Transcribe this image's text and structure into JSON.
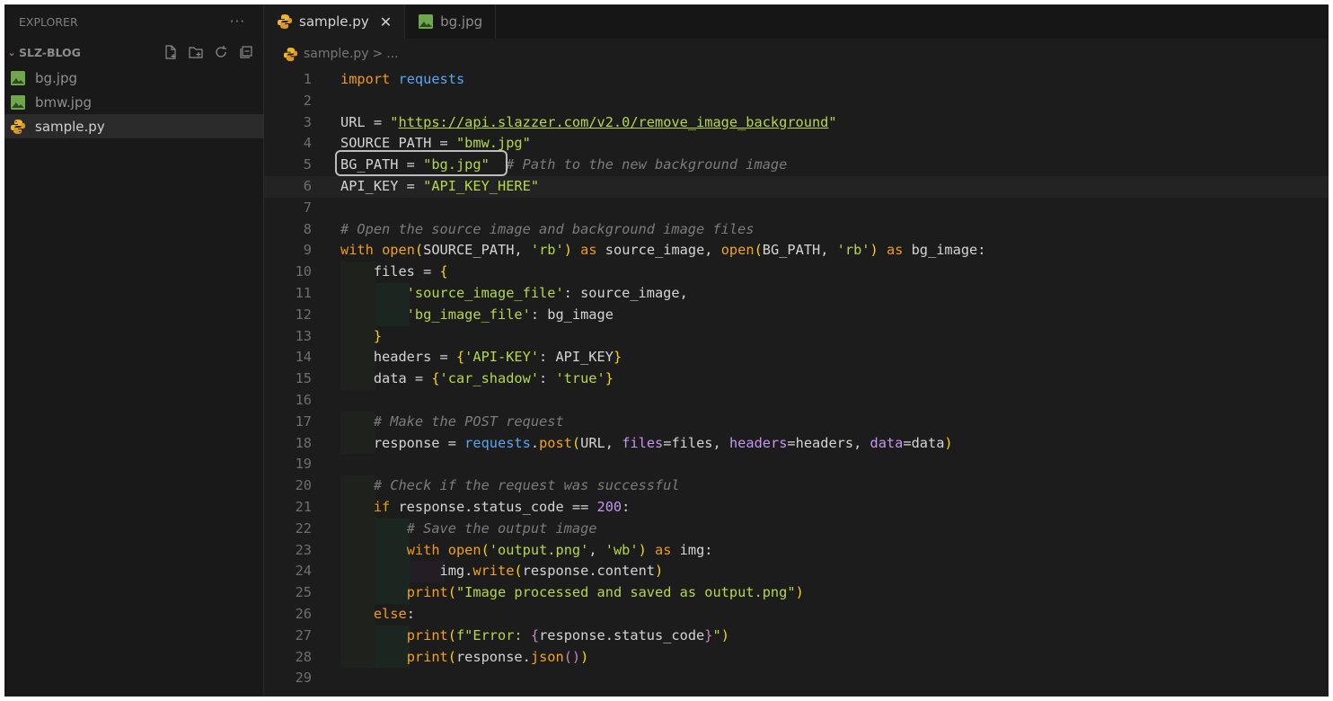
{
  "explorer": {
    "title": "EXPLORER",
    "more_icon": "ellipsis-icon",
    "folder": {
      "name": "SLZ-BLOG",
      "actions": [
        "new-file-icon",
        "new-folder-icon",
        "refresh-icon",
        "collapse-icon"
      ]
    },
    "files": [
      {
        "name": "bg.jpg",
        "icon": "image-icon",
        "active": false
      },
      {
        "name": "bmw.jpg",
        "icon": "image-icon",
        "active": false
      },
      {
        "name": "sample.py",
        "icon": "python-icon",
        "active": true
      }
    ]
  },
  "tabs": [
    {
      "label": "sample.py",
      "icon": "python-icon",
      "active": true,
      "close": "✕"
    },
    {
      "label": "bg.jpg",
      "icon": "image-icon",
      "active": false
    }
  ],
  "breadcrumb": {
    "file": "sample.py",
    "sep": ">",
    "rest": "..."
  },
  "editor": {
    "current_line": 6,
    "highlighted_line": 5,
    "lines": [
      [
        [
          "kw",
          "import"
        ],
        [
          "",
          " "
        ],
        [
          "mod",
          "requests"
        ]
      ],
      [],
      [
        [
          "",
          "URL = "
        ],
        [
          "str",
          "\""
        ],
        [
          "url",
          "https://api.slazzer.com/v2.0/remove_image_background"
        ],
        [
          "str",
          "\""
        ]
      ],
      [
        [
          "",
          "SOURCE_PATH = "
        ],
        [
          "str",
          "\"bmw.jpg\""
        ]
      ],
      [
        [
          "",
          "BG_PATH = "
        ],
        [
          "str",
          "\"bg.jpg\""
        ],
        [
          "",
          "  "
        ],
        [
          "cm",
          "# Path to the new background image"
        ]
      ],
      [
        [
          "",
          "API_KEY = "
        ],
        [
          "str",
          "\"API_KEY_HERE\""
        ]
      ],
      [],
      [
        [
          "cm",
          "# Open the source image and background image files"
        ]
      ],
      [
        [
          "kw",
          "with"
        ],
        [
          "",
          " "
        ],
        [
          "fn",
          "open"
        ],
        [
          "bk",
          "("
        ],
        [
          "",
          "SOURCE_PATH, "
        ],
        [
          "str",
          "'rb'"
        ],
        [
          "bk",
          ")"
        ],
        [
          "",
          " "
        ],
        [
          "kw",
          "as"
        ],
        [
          "",
          " source_image, "
        ],
        [
          "fn",
          "open"
        ],
        [
          "bk",
          "("
        ],
        [
          "",
          "BG_PATH, "
        ],
        [
          "str",
          "'rb'"
        ],
        [
          "bk",
          ")"
        ],
        [
          "",
          " "
        ],
        [
          "kw",
          "as"
        ],
        [
          "",
          " bg_image:"
        ]
      ],
      [
        [
          "",
          "    files = "
        ],
        [
          "bk",
          "{"
        ]
      ],
      [
        [
          "",
          "        "
        ],
        [
          "str",
          "'source_image_file'"
        ],
        [
          "",
          ": source_image,"
        ]
      ],
      [
        [
          "",
          "        "
        ],
        [
          "str",
          "'bg_image_file'"
        ],
        [
          "",
          ": bg_image"
        ]
      ],
      [
        [
          "",
          "    "
        ],
        [
          "bk",
          "}"
        ]
      ],
      [
        [
          "",
          "    headers = "
        ],
        [
          "bk",
          "{"
        ],
        [
          "str",
          "'API-KEY'"
        ],
        [
          "",
          ": API_KEY"
        ],
        [
          "bk",
          "}"
        ]
      ],
      [
        [
          "",
          "    data = "
        ],
        [
          "bk",
          "{"
        ],
        [
          "str",
          "'car_shadow'"
        ],
        [
          "",
          ": "
        ],
        [
          "str",
          "'true'"
        ],
        [
          "bk",
          "}"
        ]
      ],
      [],
      [
        [
          "",
          "    "
        ],
        [
          "cm",
          "# Make the POST request"
        ]
      ],
      [
        [
          "",
          "    response = "
        ],
        [
          "mod",
          "requests"
        ],
        [
          "",
          "."
        ],
        [
          "fn",
          "post"
        ],
        [
          "bk",
          "("
        ],
        [
          "",
          "URL, "
        ],
        [
          "prm",
          "files"
        ],
        [
          "",
          "=files, "
        ],
        [
          "prm",
          "headers"
        ],
        [
          "",
          "=headers, "
        ],
        [
          "prm",
          "data"
        ],
        [
          "",
          "=data"
        ],
        [
          "bk",
          ")"
        ]
      ],
      [],
      [
        [
          "",
          "    "
        ],
        [
          "cm",
          "# Check if the request was successful"
        ]
      ],
      [
        [
          "",
          "    "
        ],
        [
          "kw",
          "if"
        ],
        [
          "",
          " response.status_code == "
        ],
        [
          "num",
          "200"
        ],
        [
          "",
          ":"
        ]
      ],
      [
        [
          "",
          "        "
        ],
        [
          "cm",
          "# Save the output image"
        ]
      ],
      [
        [
          "",
          "        "
        ],
        [
          "kw",
          "with"
        ],
        [
          "",
          " "
        ],
        [
          "fn",
          "open"
        ],
        [
          "bk",
          "("
        ],
        [
          "str",
          "'output.png'"
        ],
        [
          "",
          ", "
        ],
        [
          "str",
          "'wb'"
        ],
        [
          "bk",
          ")"
        ],
        [
          "",
          " "
        ],
        [
          "kw",
          "as"
        ],
        [
          "",
          " img:"
        ]
      ],
      [
        [
          "",
          "            img."
        ],
        [
          "fn",
          "write"
        ],
        [
          "bk",
          "("
        ],
        [
          "",
          "response.content"
        ],
        [
          "bk",
          ")"
        ]
      ],
      [
        [
          "",
          "        "
        ],
        [
          "fn",
          "print"
        ],
        [
          "bk",
          "("
        ],
        [
          "str",
          "\"Image processed and saved as output.png\""
        ],
        [
          "bk",
          ")"
        ]
      ],
      [
        [
          "",
          "    "
        ],
        [
          "kw",
          "else"
        ],
        [
          "",
          ":"
        ]
      ],
      [
        [
          "",
          "        "
        ],
        [
          "fn",
          "print"
        ],
        [
          "bk",
          "("
        ],
        [
          "str",
          "f\"Error: "
        ],
        [
          "bk2",
          "{"
        ],
        [
          "",
          "response.status_code"
        ],
        [
          "bk2",
          "}"
        ],
        [
          "str",
          "\""
        ],
        [
          "bk",
          ")"
        ]
      ],
      [
        [
          "",
          "        "
        ],
        [
          "fn",
          "print"
        ],
        [
          "bk",
          "("
        ],
        [
          "",
          "response."
        ],
        [
          "fn",
          "json"
        ],
        [
          "bk2",
          "()"
        ],
        [
          "bk",
          ")"
        ]
      ],
      []
    ]
  }
}
